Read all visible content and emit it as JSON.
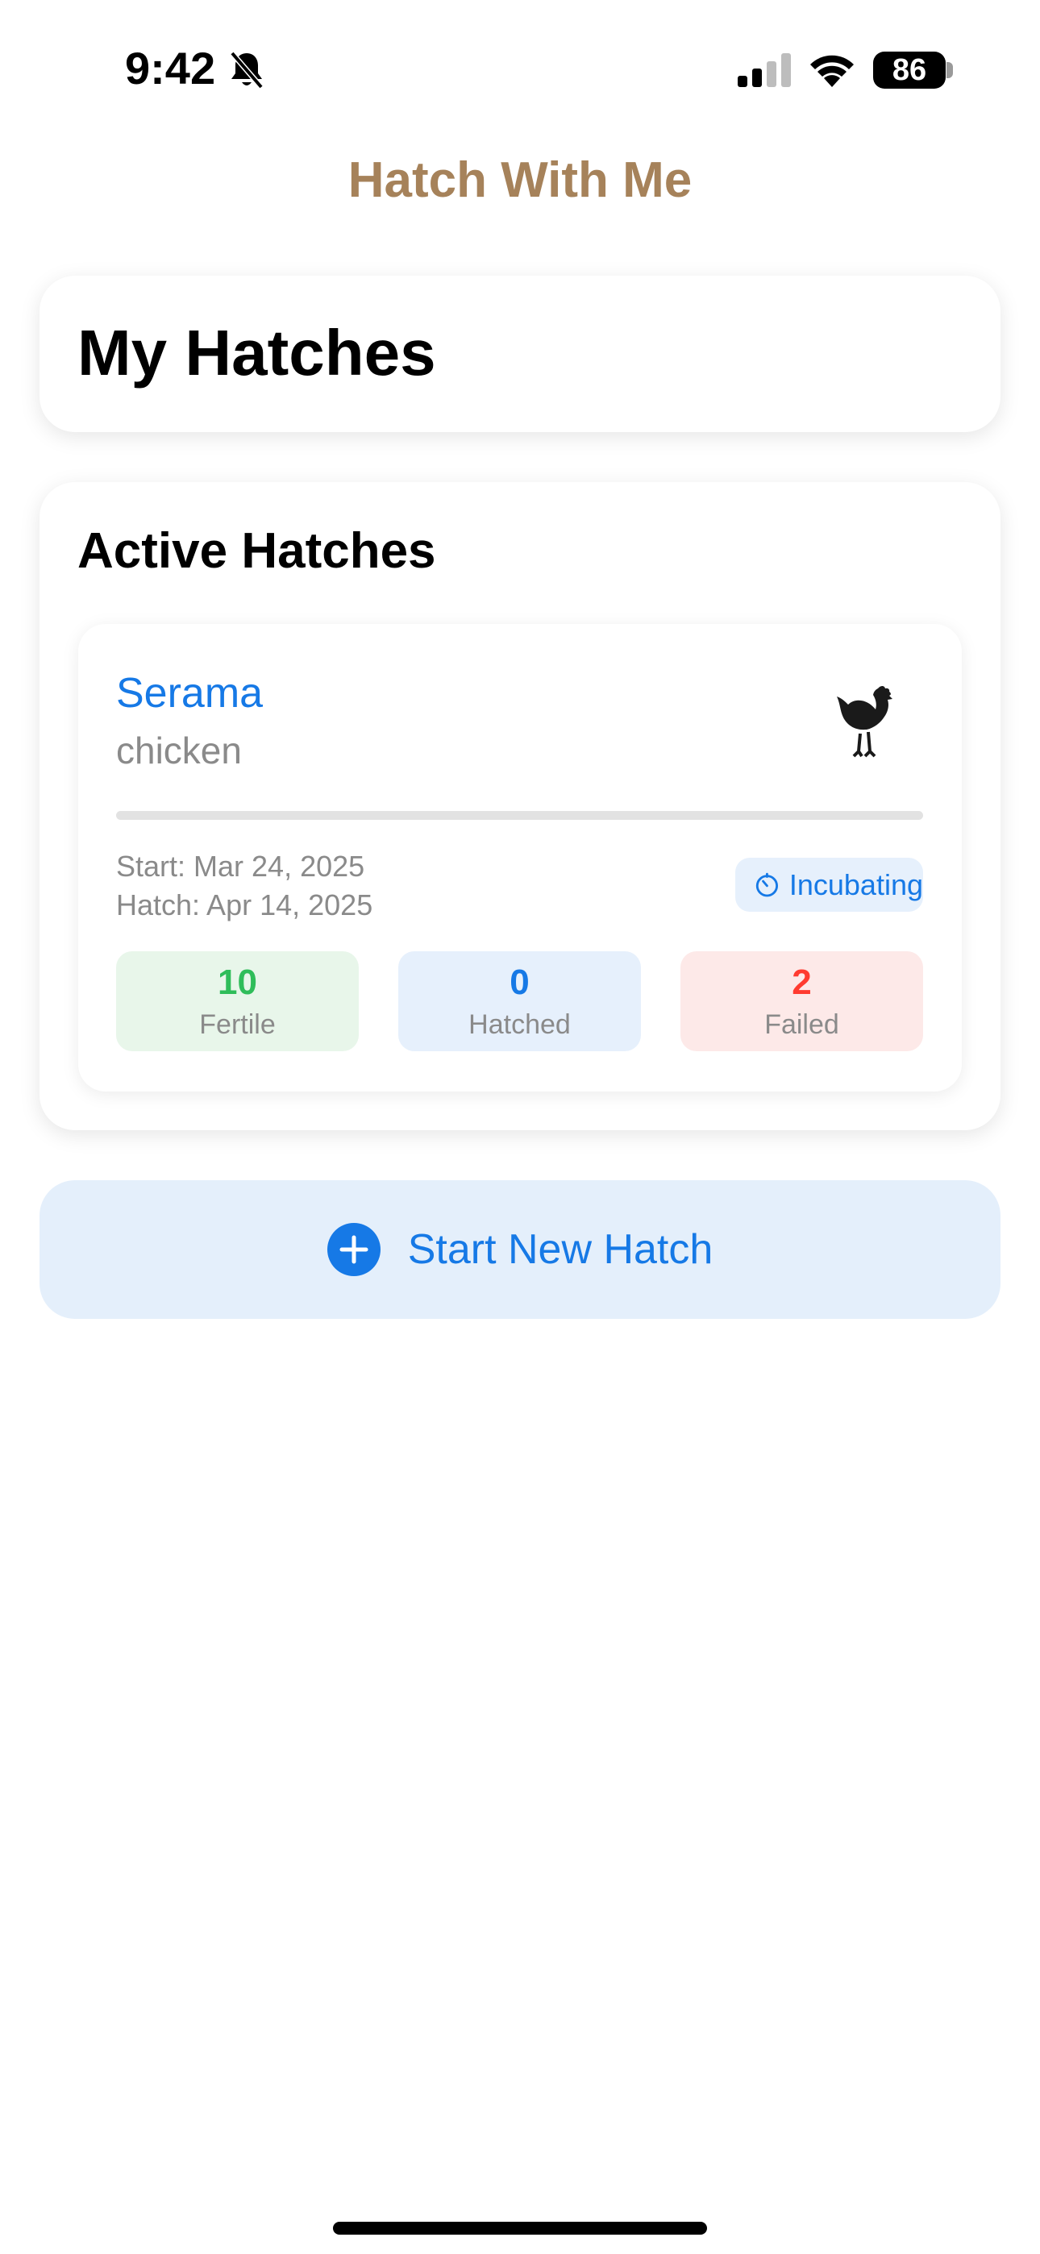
{
  "status_bar": {
    "time": "9:42",
    "battery": "86"
  },
  "app": {
    "title": "Hatch With Me"
  },
  "page": {
    "heading": "My Hatches"
  },
  "active": {
    "heading": "Active Hatches",
    "hatch": {
      "breed": "Serama",
      "species": "chicken",
      "species_icon": "chicken-icon",
      "progress": 0,
      "start": "Start: Mar 24, 2025",
      "hatch_date": "Hatch: Apr 14, 2025",
      "status": "Incubating",
      "stats": {
        "fertile": {
          "value": "10",
          "label": "Fertile"
        },
        "hatched": {
          "value": "0",
          "label": "Hatched"
        },
        "failed": {
          "value": "2",
          "label": "Failed"
        }
      }
    }
  },
  "actions": {
    "new_hatch": "Start New Hatch"
  },
  "colors": {
    "title": "#a6825a",
    "accent": "#1679e6",
    "fertile": "#2fbd5a",
    "failed": "#ff3b30"
  }
}
